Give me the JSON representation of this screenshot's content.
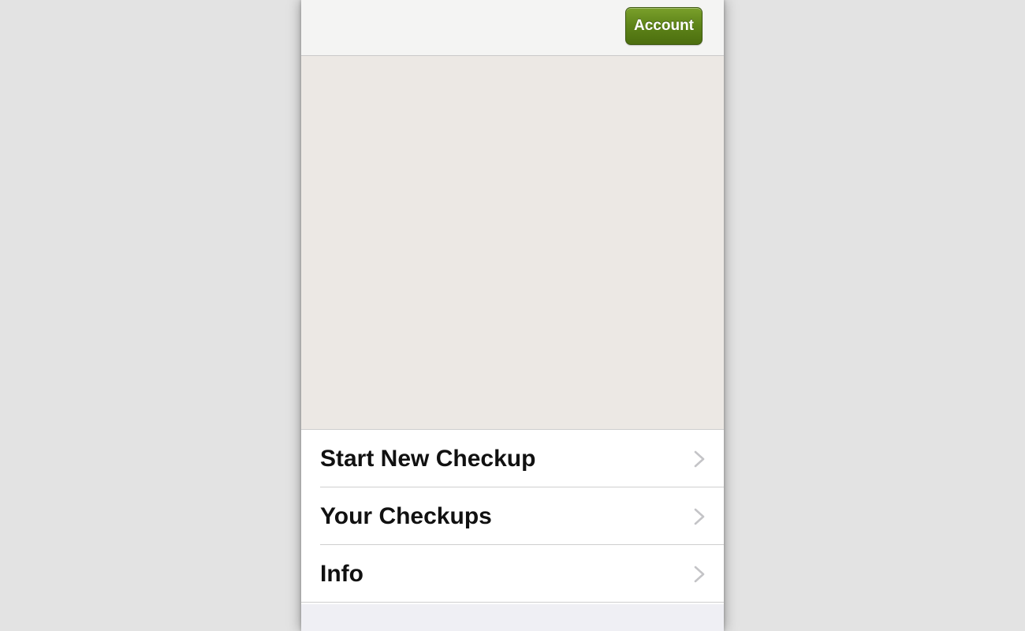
{
  "navbar": {
    "account_label": "Account"
  },
  "menu": {
    "items": [
      {
        "label": "Start New Checkup",
        "icon": "chevron-right-icon"
      },
      {
        "label": "Your Checkups",
        "icon": "chevron-right-icon"
      },
      {
        "label": "Info",
        "icon": "chevron-right-icon"
      }
    ]
  },
  "colors": {
    "accent_button": "#5e8419",
    "content_background": "#ece8e4",
    "page_background": "#e3e3e3"
  }
}
